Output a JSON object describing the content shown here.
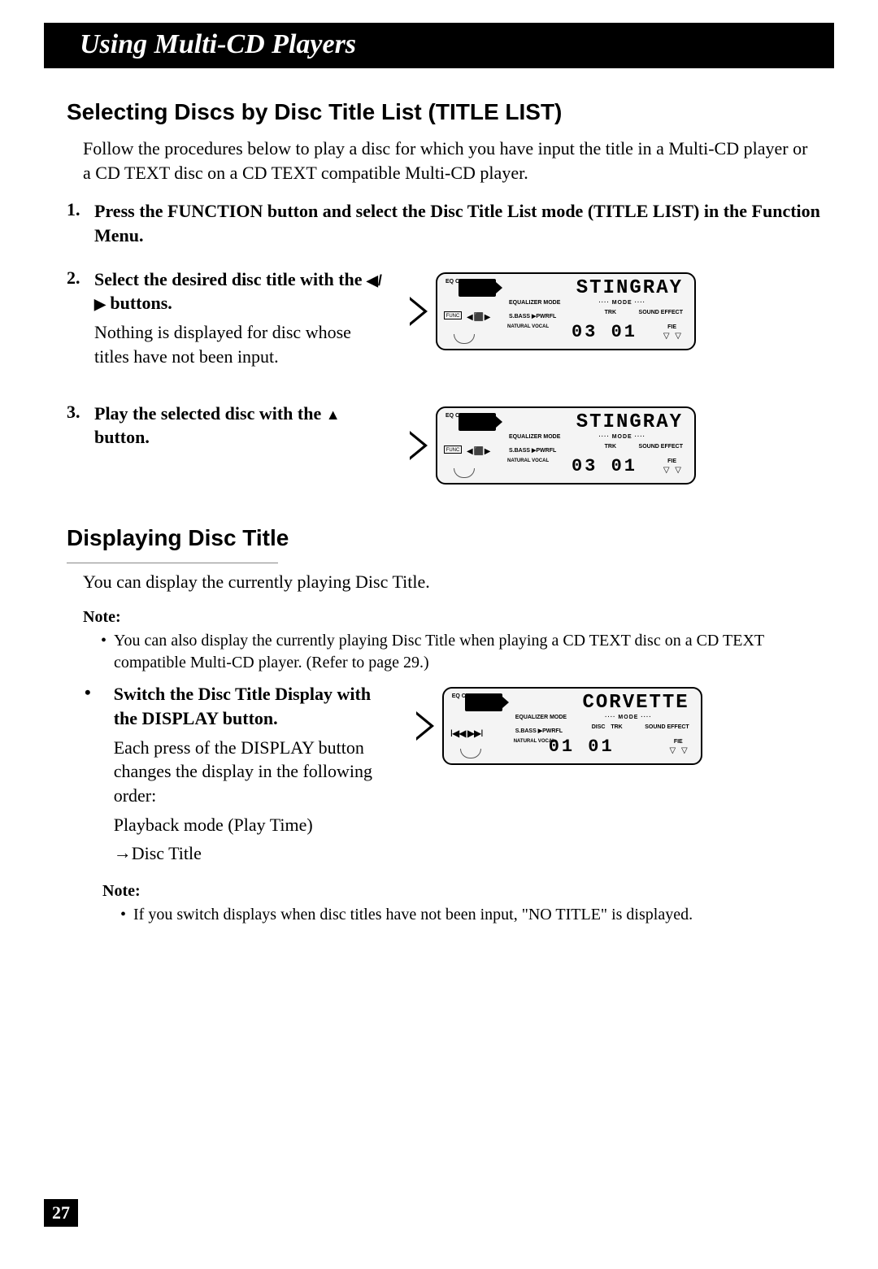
{
  "banner": "Using Multi-CD Players",
  "section1": {
    "heading": "Selecting Discs by Disc Title List (TITLE LIST)",
    "intro": "Follow the procedures below to play a disc for which you have input the title in a Multi-CD player or a CD TEXT disc on a CD TEXT compatible Multi-CD player.",
    "step1": "Press the FUNCTION button and select the Disc Title List mode (TITLE LIST) in the Function Menu.",
    "step2_title_a": "Select the desired disc title with the ",
    "step2_buttons": "◀/▶",
    "step2_title_b": " buttons.",
    "step2_body": "Nothing is displayed for disc whose titles have not been input.",
    "step3_title_a": "Play the selected disc with the ",
    "step3_button": "▲",
    "step3_title_b": " button."
  },
  "lcd1": {
    "title": "STINGRAY",
    "eq_curve": "EQ CURVE",
    "equalizer_mode": "EQUALIZER MODE",
    "mode": "···· MODE ····",
    "sbass": "S.BASS ▶PWRFL",
    "trk": "TRK",
    "sound_effect": "SOUND EFFECT",
    "natural_vocal": "NATURAL  VOCAL",
    "fie": "FIE",
    "func": "FUNC",
    "arrows": "◀ ⬛ ▶",
    "digits": "03 01",
    "fie_icons": "▽ ▽"
  },
  "lcd2": {
    "title": "STINGRAY",
    "digits": "03 01"
  },
  "section2": {
    "heading": "Displaying Disc Title",
    "intro": "You can display the currently playing Disc Title.",
    "note1_label": "Note:",
    "note1_text": "You can also display the currently playing Disc Title when playing a CD TEXT disc on a CD TEXT compatible Multi-CD player. (Refer to page 29.)",
    "bullet_title": "Switch the Disc Title Display with the DISPLAY button.",
    "bullet_body1": "Each press of the DISPLAY button changes the display in the following order:",
    "bullet_body2": "Playback mode (Play Time)",
    "bullet_body3a": "→ ",
    "bullet_body3b": "Disc Title",
    "note2_label": "Note:",
    "note2_text": "If you switch displays when disc titles have not been input, \"NO TITLE\" is displayed."
  },
  "lcd3": {
    "title": "CORVETTE",
    "disc": "DISC",
    "digits": "01 01",
    "play_icons": "I◀◀  ▶▶I"
  },
  "page_number": "27"
}
